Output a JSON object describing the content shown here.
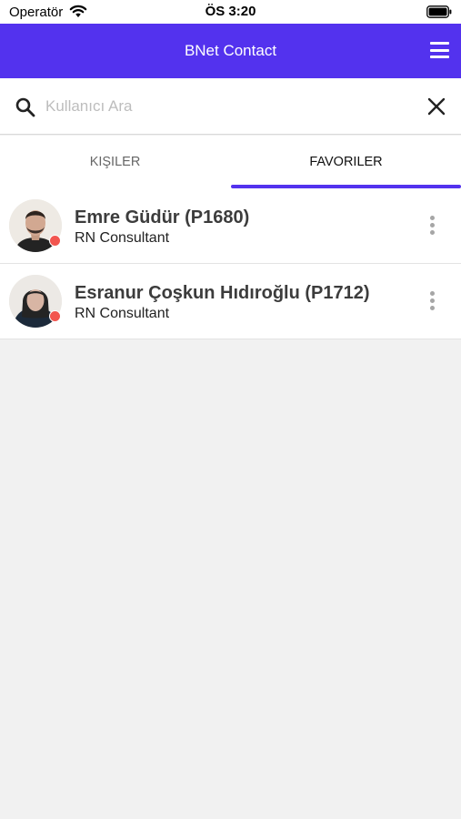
{
  "status_bar": {
    "carrier": "Operatör",
    "time": "ÖS 3:20"
  },
  "app_bar": {
    "title": "BNet Contact",
    "menu_icon": "hamburger-menu-icon"
  },
  "search": {
    "placeholder": "Kullanıcı Ara",
    "value": "",
    "search_icon": "search-icon",
    "clear_icon": "close-icon"
  },
  "tabs": [
    {
      "label": "KIŞILER",
      "active": false
    },
    {
      "label": "FAVORILER",
      "active": true
    }
  ],
  "colors": {
    "accent": "#5332ee",
    "status_offline": "#f2554f",
    "background": "#f1f1f1"
  },
  "contacts": [
    {
      "name": "Emre Güdür (P1680)",
      "role": "RN Consultant",
      "status": "offline"
    },
    {
      "name": "Esranur Çoşkun Hıdıroğlu (P1712)",
      "role": "RN Consultant",
      "status": "offline"
    }
  ]
}
